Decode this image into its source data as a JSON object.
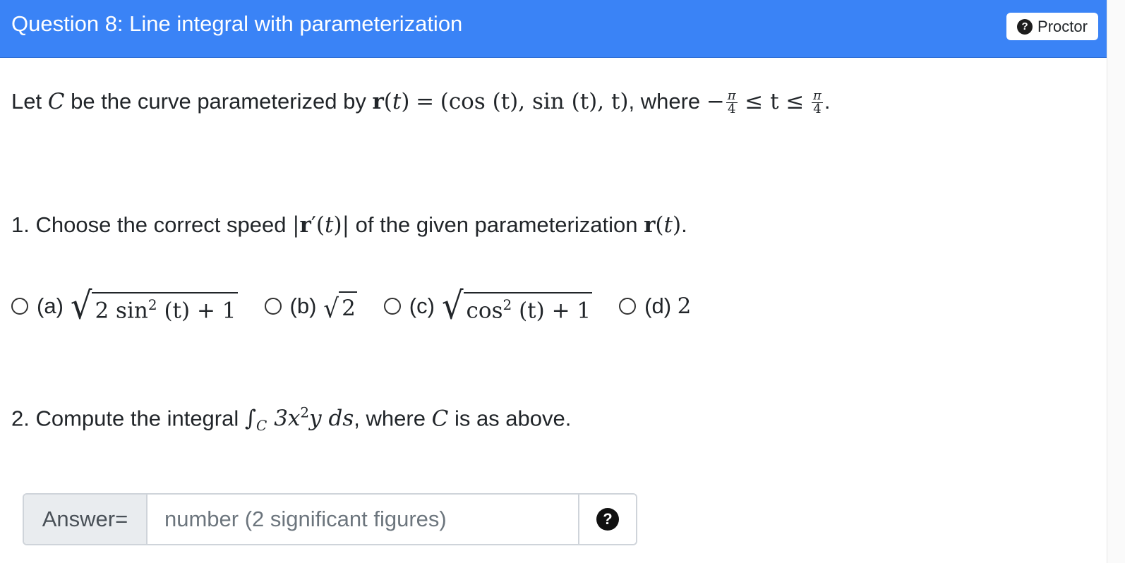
{
  "header": {
    "title": "Question 8: Line integral with parameterization",
    "proctor_label": "Proctor",
    "background_color": "#3a83f6"
  },
  "intro": {
    "prefix": "Let",
    "curve": "C",
    "mid": "be the curve parameterized by",
    "r_of_t": "r(t)",
    "equals": "=",
    "vector": "(cos (t),  sin (t),  t)",
    "where": ", where",
    "neg": "−",
    "frac_num": "π",
    "frac_den": "4",
    "middle": "≤ t ≤",
    "end": "."
  },
  "part1": {
    "prefix": "1. Choose the correct speed",
    "speed": "|r′(t)|",
    "mid": "of the given parameterization",
    "r_of_t": "r(t)",
    "end": "."
  },
  "options": [
    {
      "label": "(a)",
      "math_a": "2 sin",
      "sup": "2",
      "math_b": " (t) + 1"
    },
    {
      "label": "(b)",
      "math": "2"
    },
    {
      "label": "(c)",
      "math_a": "cos",
      "sup": "2",
      "math_b": " (t) + 1"
    },
    {
      "label": "(d)",
      "math": "2"
    }
  ],
  "part2": {
    "prefix": "2. Compute the integral",
    "integral": "∫",
    "sub": "C",
    "expr_a": "3x",
    "sup": "2",
    "expr_b": "y ds",
    "suffix_a": ", where",
    "curve": "C",
    "suffix_b": "is as above."
  },
  "answer": {
    "label": "Answer=",
    "placeholder": "number (2 significant figures)",
    "value": ""
  }
}
